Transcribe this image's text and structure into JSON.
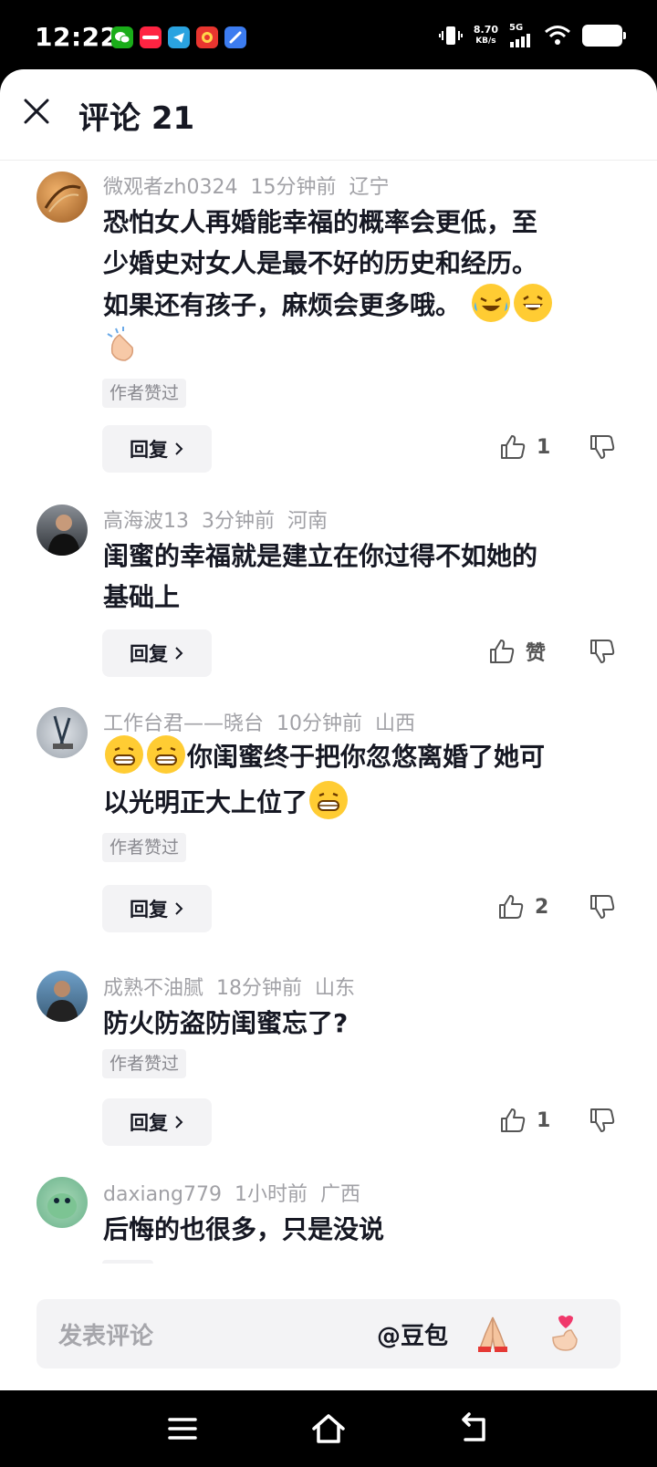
{
  "status_bar": {
    "time": "12:22",
    "net_speed_value": "8.70",
    "net_speed_unit": "KB/s",
    "network": "5G",
    "apps": [
      "wechat-icon",
      "xiaohongshu-icon",
      "telegram-icon",
      "game-icon",
      "notes-icon"
    ]
  },
  "header": {
    "title": "评论 21"
  },
  "comments": [
    {
      "user": "微观者zh0324",
      "time": "15分钟前",
      "location": "辽宁",
      "text_lines": [
        "恐怕女人再婚能幸福的概率会更低，至",
        "少婚史对女人是最不好的历史和经历。",
        "如果还有孩子，麻烦会更多哦。"
      ],
      "emojis": [
        "crying-laughing-emoji",
        "grinning-emoji",
        "clapping-hands-emoji"
      ],
      "badge": "作者赞过",
      "reply": "回复",
      "likes": "1"
    },
    {
      "user": "高海波13",
      "time": "3分钟前",
      "location": "河南",
      "text_lines": [
        "闺蜜的幸福就是建立在你过得不如她的",
        "基础上"
      ],
      "reply": "回复",
      "likes": "赞"
    },
    {
      "user": "工作台君——晓台",
      "time": "10分钟前",
      "location": "山西",
      "text_lines": [
        "你闺蜜终于把你忽悠离婚了她可",
        "以光明正大上位了"
      ],
      "emojis": [
        "grimacing-emoji",
        "grimacing-emoji",
        "grimacing-emoji"
      ],
      "badge": "作者赞过",
      "reply": "回复",
      "likes": "2"
    },
    {
      "user": "成熟不油腻",
      "time": "18分钟前",
      "location": "山东",
      "text_lines": [
        "防火防盗防闺蜜忘了?"
      ],
      "badge": "作者赞过",
      "reply": "回复",
      "likes": "1"
    },
    {
      "user": "daxiang779",
      "time": "1小时前",
      "location": "广西",
      "text_lines": [
        "后悔的也很多，只是没说"
      ]
    }
  ],
  "input": {
    "placeholder": "发表评论",
    "mention": "@豆包",
    "quick_emojis": [
      "folded-hands-emoji",
      "finger-heart-emoji"
    ]
  },
  "colors": {
    "text": "#161823",
    "meta": "#a1a1a6",
    "surface": "#f3f3f5"
  }
}
